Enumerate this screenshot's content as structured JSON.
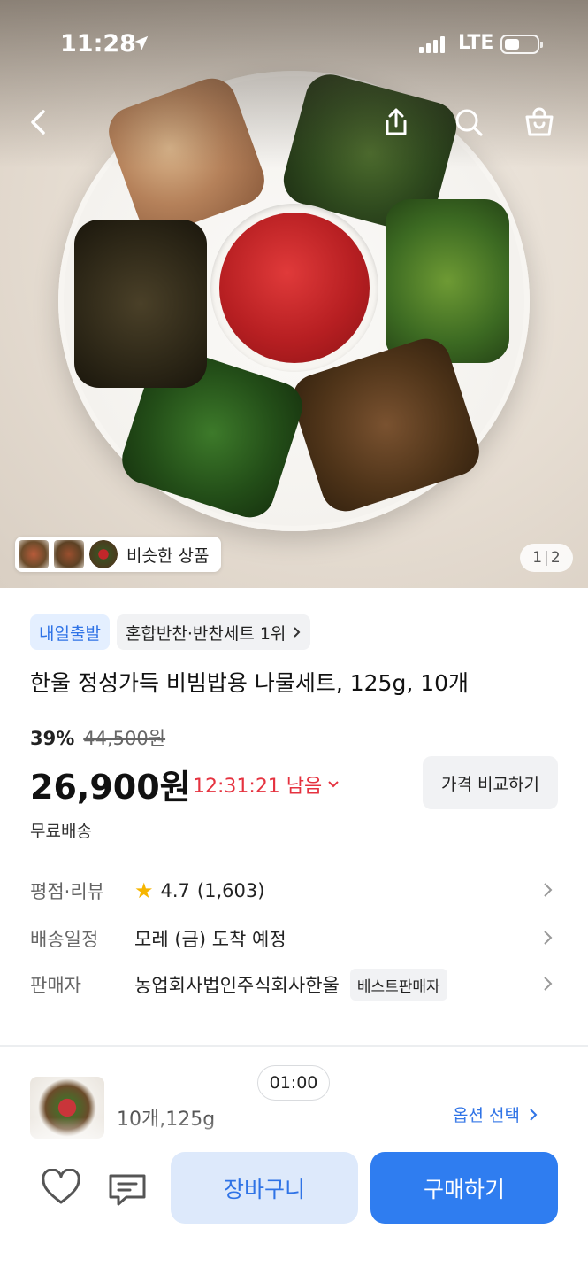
{
  "status_bar": {
    "time": "11:28",
    "network": "LTE"
  },
  "hero": {
    "similar_label": "비슷한 상품",
    "pager_current": "1",
    "pager_total": "2"
  },
  "badges": {
    "delivery": "내일출발",
    "ranking": "혼합반찬·반찬세트 1위"
  },
  "product": {
    "title": "한울 정성가득 비빔밥용 나물세트, 125g, 10개",
    "discount": "39%",
    "original_price": "44,500원",
    "price": "26,900원",
    "timer": "12:31:21 남음",
    "compare_label": "가격 비교하기",
    "shipping": "무료배송"
  },
  "info": {
    "rating_label": "평점·리뷰",
    "rating_value": "4.7",
    "review_count": "(1,603)",
    "delivery_label": "배송일정",
    "delivery_value": "모레 (금) 도착 예정",
    "seller_label": "판매자",
    "seller_name": "농업회사법인주식회사한울",
    "seller_badge": "베스트판매자"
  },
  "option": {
    "time_chip": "01:00",
    "text": "10개,125g",
    "select_label": "옵션 선택"
  },
  "bottom": {
    "cart_label": "장바구니",
    "buy_label": "구매하기"
  },
  "colors": {
    "accent": "#2f7df0",
    "timer": "#e5323f",
    "star": "#f6b500"
  }
}
